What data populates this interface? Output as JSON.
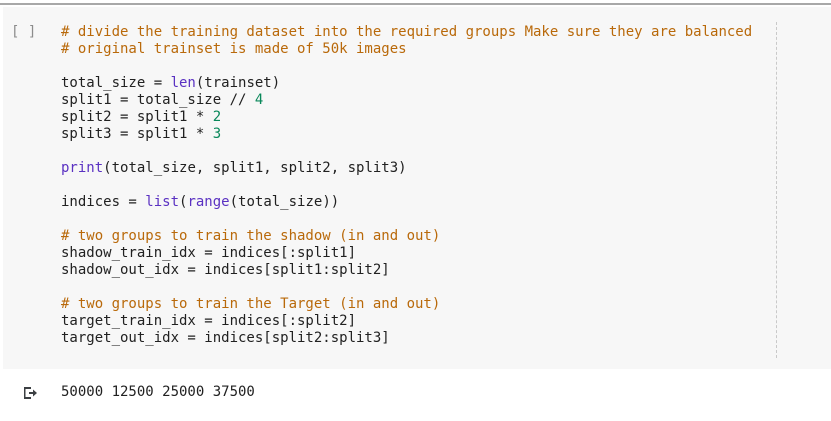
{
  "cell": {
    "run_indicator": "[ ]",
    "lines": [
      {
        "kind": "code",
        "tokens": [
          {
            "t": "# divide the training dataset into the required groups Make sure they are balanced",
            "c": "comment"
          }
        ]
      },
      {
        "kind": "code",
        "tokens": [
          {
            "t": "# original trainset is made of 50k images",
            "c": "comment"
          }
        ]
      },
      {
        "kind": "blank"
      },
      {
        "kind": "code",
        "tokens": [
          {
            "t": "total_size = ",
            "c": "plain"
          },
          {
            "t": "len",
            "c": "builtin"
          },
          {
            "t": "(trainset)",
            "c": "plain"
          }
        ]
      },
      {
        "kind": "code",
        "tokens": [
          {
            "t": "split1 = total_size // ",
            "c": "plain"
          },
          {
            "t": "4",
            "c": "num"
          }
        ]
      },
      {
        "kind": "code",
        "tokens": [
          {
            "t": "split2 = split1 * ",
            "c": "plain"
          },
          {
            "t": "2",
            "c": "num"
          }
        ]
      },
      {
        "kind": "code",
        "tokens": [
          {
            "t": "split3 = split1 * ",
            "c": "plain"
          },
          {
            "t": "3",
            "c": "num"
          }
        ]
      },
      {
        "kind": "blank"
      },
      {
        "kind": "code",
        "tokens": [
          {
            "t": "print",
            "c": "builtin"
          },
          {
            "t": "(total_size, split1, split2, split3)",
            "c": "plain"
          }
        ]
      },
      {
        "kind": "blank"
      },
      {
        "kind": "code",
        "tokens": [
          {
            "t": "indices = ",
            "c": "plain"
          },
          {
            "t": "list",
            "c": "builtin"
          },
          {
            "t": "(",
            "c": "plain"
          },
          {
            "t": "range",
            "c": "builtin"
          },
          {
            "t": "(total_size))",
            "c": "plain"
          }
        ]
      },
      {
        "kind": "blank"
      },
      {
        "kind": "code",
        "tokens": [
          {
            "t": "# two groups to train the shadow (in and out)",
            "c": "comment"
          }
        ]
      },
      {
        "kind": "code",
        "tokens": [
          {
            "t": "shadow_train_idx = indices[:split1]",
            "c": "plain"
          }
        ]
      },
      {
        "kind": "code",
        "tokens": [
          {
            "t": "shadow_out_idx = indices[split1:split2]",
            "c": "plain"
          }
        ]
      },
      {
        "kind": "blank"
      },
      {
        "kind": "code",
        "tokens": [
          {
            "t": "# two groups to train the Target (in and out)",
            "c": "comment"
          }
        ]
      },
      {
        "kind": "code",
        "tokens": [
          {
            "t": "target_train_idx = indices[:split2]",
            "c": "plain"
          }
        ]
      },
      {
        "kind": "code",
        "tokens": [
          {
            "t": "target_out_idx = indices[split2:split3]",
            "c": "plain"
          }
        ]
      }
    ]
  },
  "output": {
    "icon": "output-redirect-icon",
    "text": "50000 12500 25000 37500"
  },
  "colors": {
    "comment": "#b9690a",
    "number": "#09885a",
    "builtin": "#5a31c2",
    "text": "#212121",
    "cell_background": "#f7f7f7"
  }
}
